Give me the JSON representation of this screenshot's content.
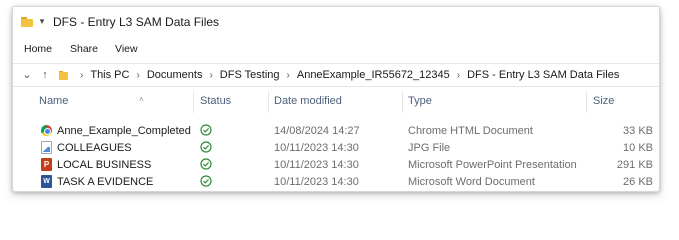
{
  "window": {
    "title": "DFS - Entry L3 SAM Data Files"
  },
  "ribbon": {
    "tabs": [
      "Home",
      "Share",
      "View"
    ]
  },
  "address": {
    "crumbs": [
      "This PC",
      "Documents",
      "DFS Testing",
      "AnneExample_IR55672_12345",
      "DFS - Entry L3 SAM Data Files"
    ]
  },
  "columns": {
    "name": "Name",
    "status": "Status",
    "date_modified": "Date modified",
    "type": "Type",
    "size": "Size"
  },
  "files": [
    {
      "name": "Anne_Example_Completed",
      "icon": "chrome-html-icon",
      "date": "14/08/2024 14:27",
      "type": "Chrome HTML Document",
      "size": "33 KB"
    },
    {
      "name": "COLLEAGUES",
      "icon": "jpg-file-icon",
      "date": "10/11/2023 14:30",
      "type": "JPG File",
      "size": "10 KB"
    },
    {
      "name": "LOCAL BUSINESS",
      "icon": "powerpoint-icon",
      "date": "10/11/2023 14:30",
      "type": "Microsoft PowerPoint Presentation",
      "size": "291 KB"
    },
    {
      "name": "TASK A EVIDENCE",
      "icon": "word-document-icon",
      "date": "10/11/2023 14:30",
      "type": "Microsoft Word Document",
      "size": "26 KB"
    }
  ],
  "colors": {
    "status_green": "#2e8b3a",
    "header_text": "#4c607a",
    "folder_yellow": "#f2c341"
  }
}
